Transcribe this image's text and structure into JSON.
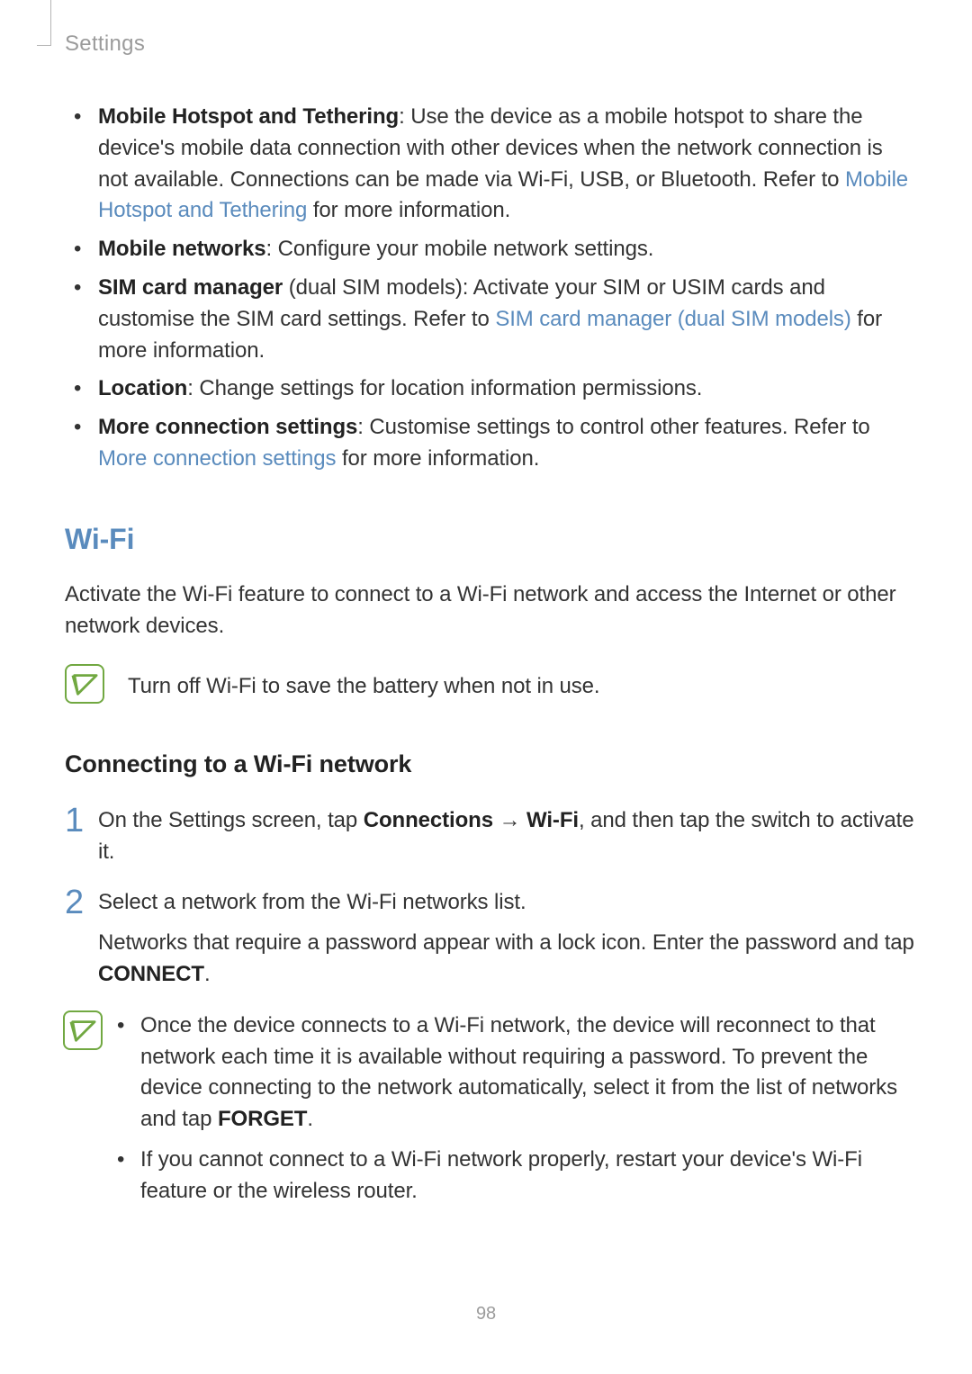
{
  "header": {
    "section": "Settings"
  },
  "bullets": {
    "hotspot_label": "Mobile Hotspot and Tethering",
    "hotspot_text": ": Use the device as a mobile hotspot to share the device's mobile data connection with other devices when the network connection is not available. Connections can be made via Wi-Fi, USB, or Bluetooth. Refer to ",
    "hotspot_link": "Mobile Hotspot and Tethering",
    "hotspot_tail": " for more information.",
    "networks_label": "Mobile networks",
    "networks_text": ": Configure your mobile network settings.",
    "sim_label": "SIM card manager",
    "sim_paren": " (dual SIM models): Activate your SIM or USIM cards and customise the SIM card settings. Refer to ",
    "sim_link": "SIM card manager (dual SIM models)",
    "sim_tail": " for more information.",
    "location_label": "Location",
    "location_text": ": Change settings for location information permissions.",
    "more_label": "More connection settings",
    "more_text": ": Customise settings to control other features. Refer to ",
    "more_link": "More connection settings",
    "more_tail": " for more information."
  },
  "wifi": {
    "heading": "Wi-Fi",
    "intro": "Activate the Wi-Fi feature to connect to a Wi-Fi network and access the Internet or other network devices.",
    "tip": "Turn off Wi-Fi to save the battery when not in use."
  },
  "connect": {
    "heading": "Connecting to a Wi-Fi network",
    "step1_a": "On the Settings screen, tap ",
    "step1_b": "Connections",
    "step1_arrow": " → ",
    "step1_c": "Wi-Fi",
    "step1_d": ", and then tap the switch to activate it.",
    "step2": "Select a network from the Wi-Fi networks list.",
    "step2_sub_a": "Networks that require a password appear with a lock icon. Enter the password and tap ",
    "step2_sub_b": "CONNECT",
    "step2_sub_c": "."
  },
  "tips": {
    "t1_a": "Once the device connects to a Wi-Fi network, the device will reconnect to that network each time it is available without requiring a password. To prevent the device connecting to the network automatically, select it from the list of networks and tap ",
    "t1_b": "FORGET",
    "t1_c": ".",
    "t2": "If you cannot connect to a Wi-Fi network properly, restart your device's Wi-Fi feature or the wireless router."
  },
  "page_number": "98"
}
